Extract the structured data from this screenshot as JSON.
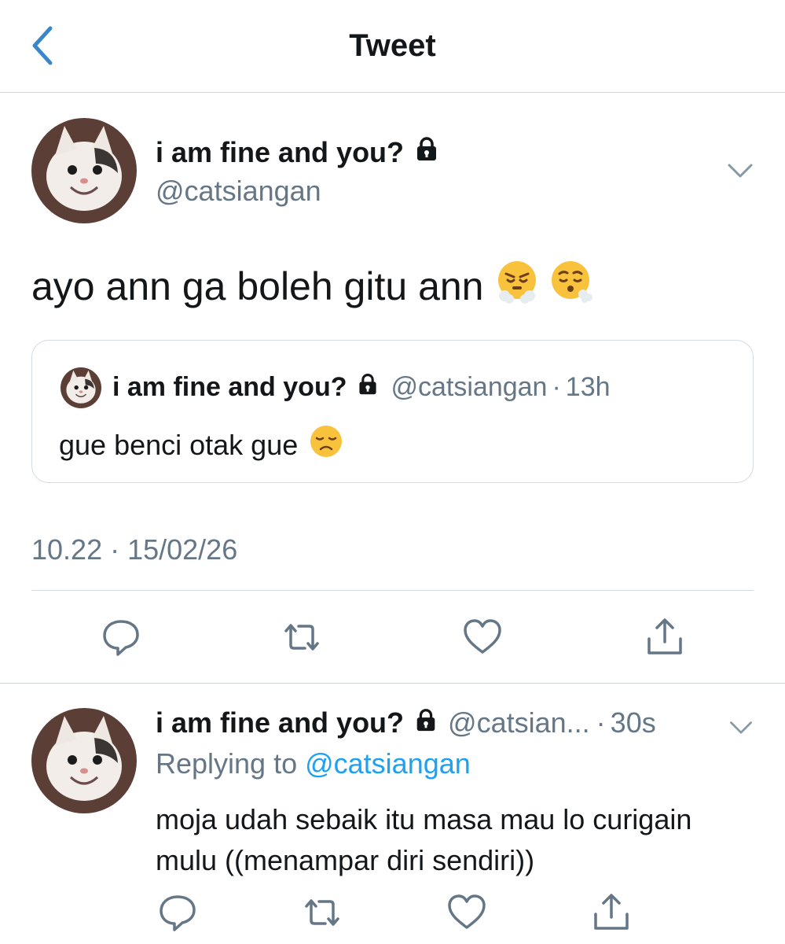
{
  "header": {
    "title": "Tweet",
    "back_icon": "chevron-left-icon"
  },
  "tweet": {
    "display_name": "i am fine and you?",
    "handle": "@catsiangan",
    "text": "ayo ann ga boleh gitu ann",
    "emojis": [
      "face-with-steam-icon",
      "exhaling-face-icon"
    ],
    "timestamp": "10.22 · 15/02/26",
    "quoted": {
      "display_name": "i am fine and you?",
      "handle": "@catsiangan",
      "separator": "·",
      "time": "13h",
      "text": "gue benci otak gue",
      "emoji": "disappointed-face-icon"
    }
  },
  "reply": {
    "display_name": "i am fine and you?",
    "handle": "@catsian...",
    "separator": "·",
    "time": "30s",
    "replying_label": "Replying to",
    "replying_handle": "@catsiangan",
    "text": "moja udah sebaik itu masa mau lo curigain mulu ((menampar diri sendiri))"
  },
  "colors": {
    "text": "#14171a",
    "muted": "#657786",
    "link": "#1da1f2",
    "back_icon": "#3a86c8",
    "border": "#d3dae0"
  }
}
